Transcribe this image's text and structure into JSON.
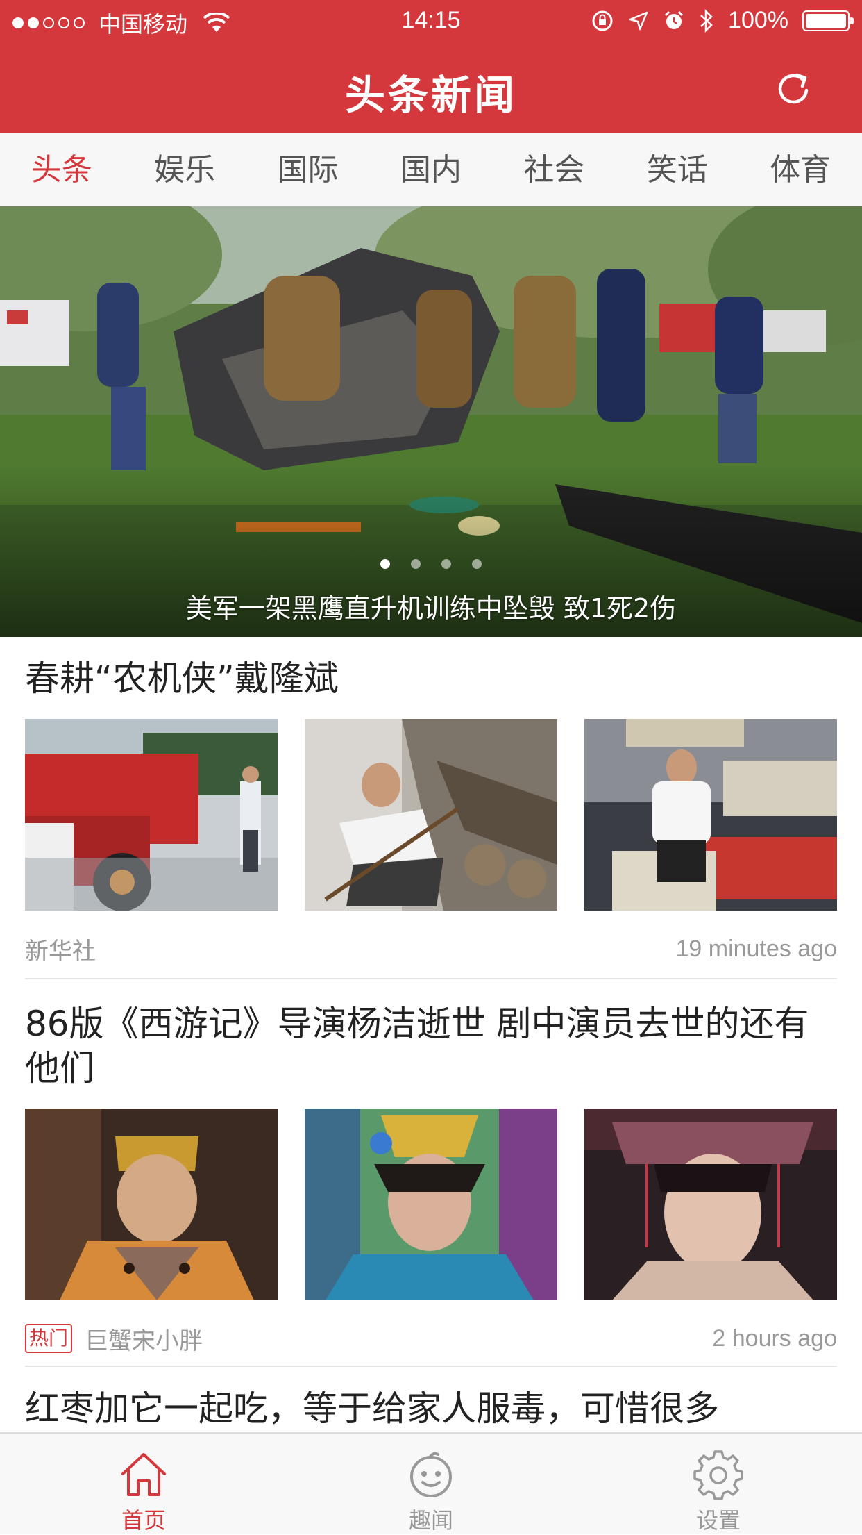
{
  "status_bar": {
    "carrier": "中国移动",
    "time": "14:15",
    "battery_text": "100%",
    "battery_level": 1.0,
    "signal_bars": 2,
    "signal_total": 5
  },
  "nav": {
    "title": "头条新闻",
    "refresh_icon": "refresh-icon"
  },
  "tabs": [
    {
      "label": "头条",
      "active": true
    },
    {
      "label": "娱乐",
      "active": false
    },
    {
      "label": "国际",
      "active": false
    },
    {
      "label": "国内",
      "active": false
    },
    {
      "label": "社会",
      "active": false
    },
    {
      "label": "笑话",
      "active": false
    },
    {
      "label": "体育",
      "active": false
    }
  ],
  "banner": {
    "caption": "美军一架黑鹰直升机训练中坠毁 致1死2伤",
    "page_count": 4,
    "current_page": 1
  },
  "articles": [
    {
      "title": "春耕“农机侠”戴隆斌",
      "source": "新华社",
      "time": "19 minutes ago",
      "hot": false
    },
    {
      "title": "86版《西游记》导演杨洁逝世  剧中演员去世的还有他们",
      "source": "巨蟹宋小胖",
      "time": "2 hours ago",
      "hot": true,
      "hot_label": "热门"
    },
    {
      "title": "红枣加它一起吃，等于给家人服毒，可惜很多"
    }
  ],
  "tabbar": [
    {
      "label": "首页",
      "icon": "home-icon",
      "active": true
    },
    {
      "label": "趣闻",
      "icon": "smiley-icon",
      "active": false
    },
    {
      "label": "设置",
      "icon": "gear-icon",
      "active": false
    }
  ],
  "colors": {
    "brand_red": "#d5383c",
    "tab_inactive": "#555555",
    "meta_gray": "#999999"
  }
}
